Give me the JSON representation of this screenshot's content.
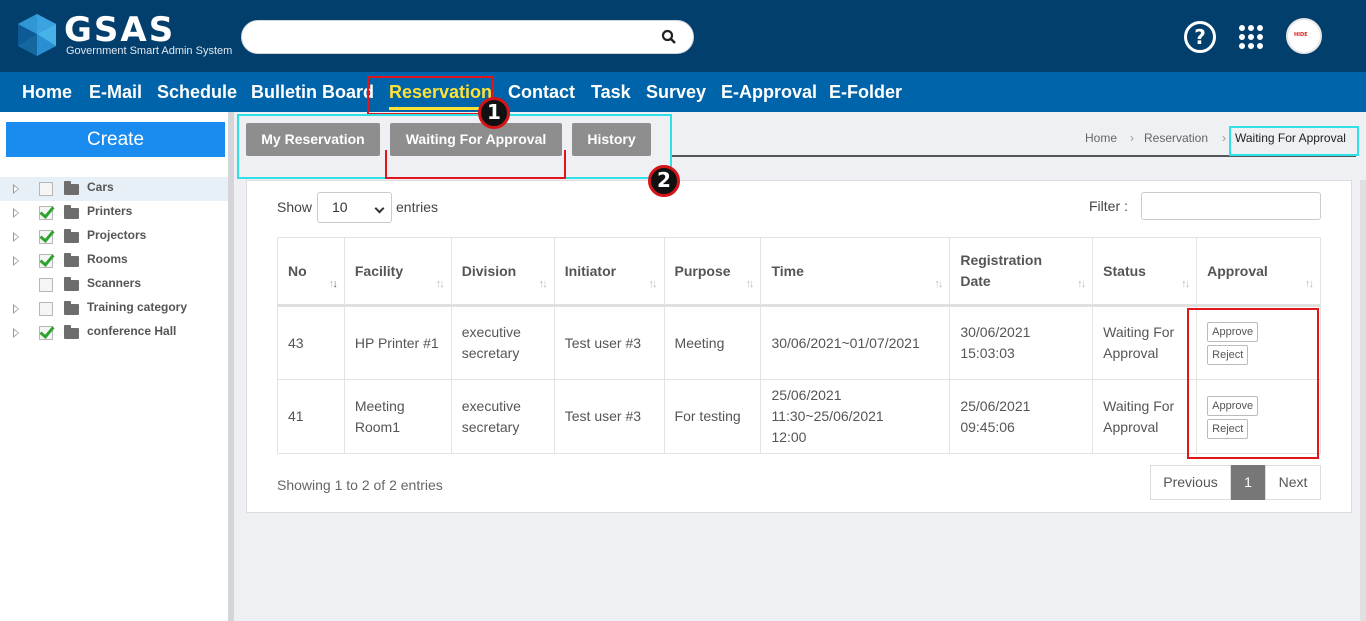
{
  "header": {
    "logo_text": "GSAS",
    "logo_subtitle": "Government Smart Admin System",
    "help_icon": "?",
    "avatar_text": "HIDE"
  },
  "nav": {
    "items": [
      "Home",
      "E-Mail",
      "Schedule",
      "Bulletin Board",
      "Reservation",
      "Contact",
      "Task",
      "Survey",
      "E-Approval",
      "E-Folder"
    ],
    "active": "Reservation"
  },
  "sidebar": {
    "create_label": "Create",
    "tree": [
      {
        "label": "Cars",
        "checked": false
      },
      {
        "label": "Printers",
        "checked": true
      },
      {
        "label": "Projectors",
        "checked": true
      },
      {
        "label": "Rooms",
        "checked": true
      },
      {
        "label": "Scanners",
        "checked": false
      },
      {
        "label": "Training category",
        "checked": false
      },
      {
        "label": "conference Hall",
        "checked": true
      }
    ]
  },
  "subtabs": [
    "My Reservation",
    "Waiting For Approval",
    "History"
  ],
  "breadcrumb": {
    "home": "Home",
    "section": "Reservation",
    "current": "Waiting For Approval"
  },
  "list": {
    "show_label": "Show",
    "page_size": "10",
    "entries_label": "entries",
    "filter_label": "Filter :",
    "columns": [
      "No",
      "Facility",
      "Division",
      "Initiator",
      "Purpose",
      "Time",
      "Registration Date",
      "Status",
      "Approval"
    ],
    "rows": [
      {
        "no": "43",
        "facility": "HP Printer #1",
        "division": "executive secretary",
        "initiator": "Test user #3",
        "purpose": "Meeting",
        "time": "30/06/2021~01/07/2021",
        "registration_date": "30/06/2021 15:03:03",
        "status": "Waiting For Approval",
        "approve": "Approve",
        "reject": "Reject"
      },
      {
        "no": "41",
        "facility": "Meeting Room1",
        "division": "executive secretary",
        "initiator": "Test user #3",
        "purpose": "For testing",
        "time": "25/06/2021 11:30~25/06/2021 12:00",
        "registration_date": "25/06/2021 09:45:06",
        "status": "Waiting For Approval",
        "approve": "Approve",
        "reject": "Reject"
      }
    ],
    "info": "Showing 1 to 2 of 2 entries",
    "pager": {
      "previous": "Previous",
      "current": "1",
      "next": "Next"
    }
  },
  "annotations": {
    "marker1": "1",
    "marker2": "2"
  },
  "colors": {
    "header_bg": "#033f6c",
    "nav_bg": "#0064aa",
    "active_nav": "#ffe135",
    "create_bg": "#1a8cf0",
    "tab_bg": "#8e8e8e",
    "annotation_red": "#e0161a",
    "annotation_cyan": "#2fe0e6"
  }
}
